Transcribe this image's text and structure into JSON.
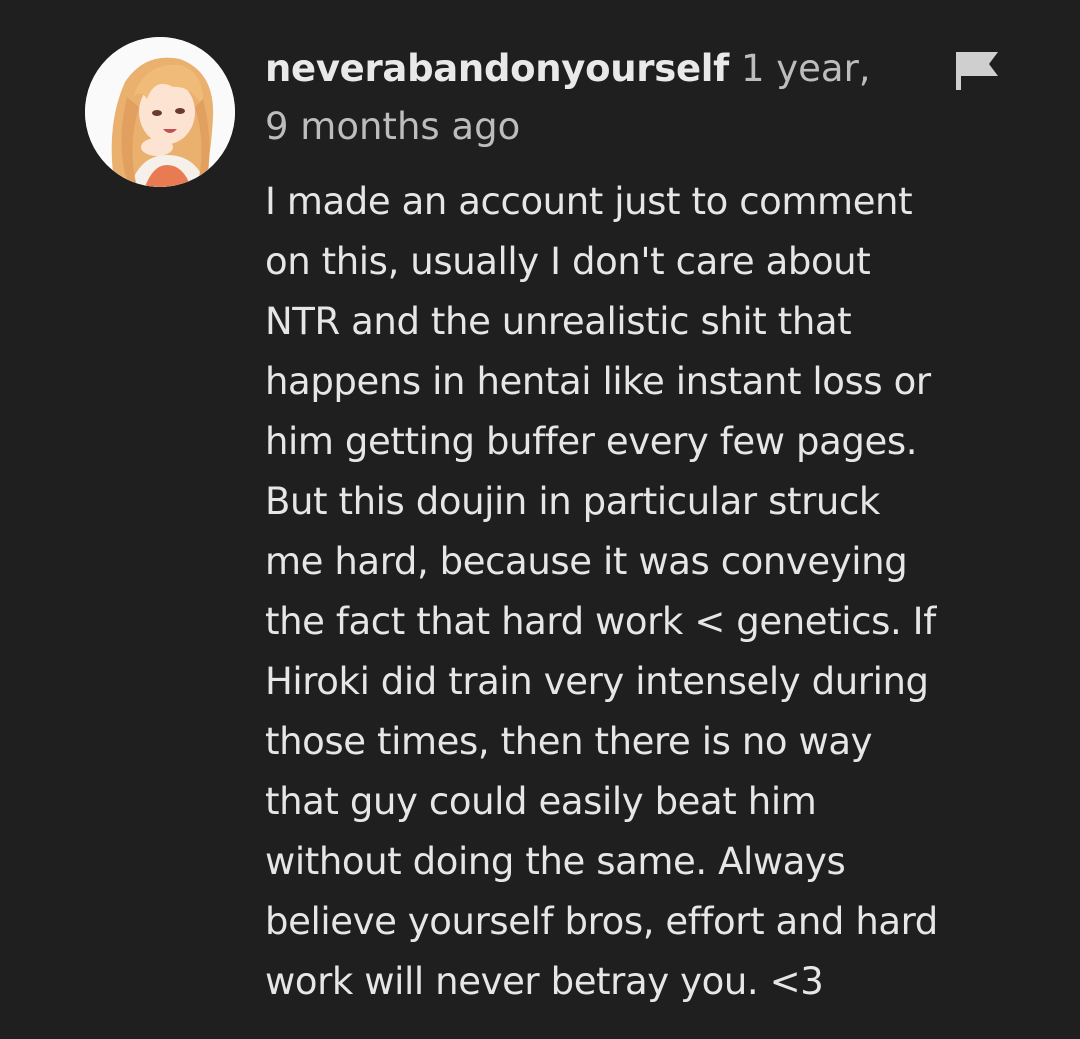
{
  "comment": {
    "author": {
      "username": "neverabandonyourself",
      "avatar_icon": "anime-avatar"
    },
    "timestamp": "1 year, 9 months ago",
    "flag_icon": "flag-icon",
    "body": "I made an account just to comment\non this, usually I don't care about\nNTR and the unrealistic shit that\nhappens in hentai like instant loss or\nhim getting buffer every few pages.\nBut this doujin in particular struck\nme hard, because it was conveying\nthe fact that hard work < genetics. If\nHiroki did train very intensely during\nthose times, then there is no way\nthat guy could easily beat him\nwithout doing the same. Always\nbelieve yourself bros, effort and hard\nwork will never betray you. <3"
  },
  "colors": {
    "background": "#1f1f1f",
    "username": "#e9e9e9",
    "timestamp": "#bdbdbd",
    "body_text": "#e6e6e6"
  }
}
